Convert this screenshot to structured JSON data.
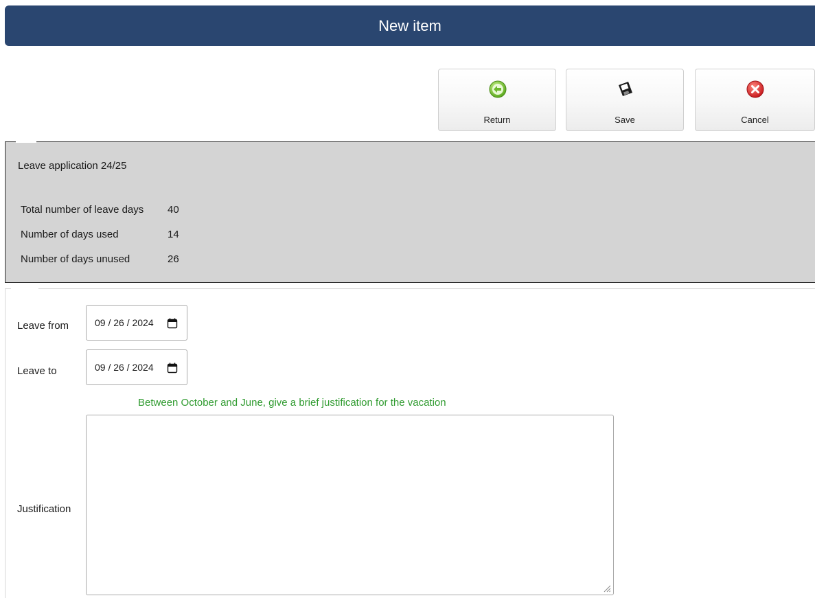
{
  "header": {
    "title": "New item",
    "background": "#2a4670"
  },
  "toolbar": {
    "return_label": "Return",
    "save_label": "Save",
    "cancel_label": "Cancel",
    "return_icon": "arrow-left-circle-icon",
    "save_icon": "floppy-disk-icon",
    "cancel_icon": "x-circle-icon"
  },
  "summary": {
    "title": "Leave application 24/25",
    "rows": [
      {
        "label": "Total number of leave days",
        "value": "40"
      },
      {
        "label": "Number of days used",
        "value": "14"
      },
      {
        "label": "Number of days unused",
        "value": "26"
      }
    ]
  },
  "form": {
    "leave_from_label": "Leave from",
    "leave_from_value": "09 / 26 / 2024",
    "leave_to_label": "Leave to",
    "leave_to_value": "09 / 26 / 2024",
    "hint": "Between October and June, give a brief justification for the vacation",
    "hint_color": "#2e9a2e",
    "justification_label": "Justification",
    "justification_value": ""
  }
}
